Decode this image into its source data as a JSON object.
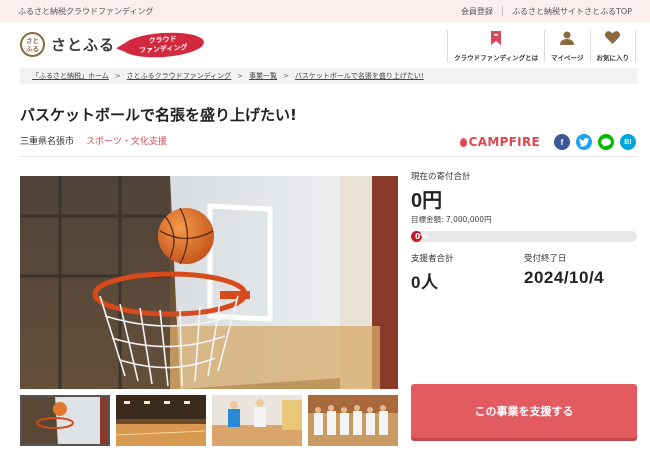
{
  "topbar": {
    "tagline": "ふるさと納税クラウドファンディング",
    "register": "会員登録",
    "site_top": "ふるさと納税サイトさとふるTOP"
  },
  "header": {
    "logo_mark": "さと\nふる",
    "logo_text": "さとふる",
    "badge_line1": "クラウド",
    "badge_line2": "ファンディング",
    "nav": [
      {
        "label": "クラウドファンディングとは",
        "icon": "bookmark-icon"
      },
      {
        "label": "マイページ",
        "icon": "user-icon"
      },
      {
        "label": "お気に入り",
        "icon": "heart-icon"
      }
    ]
  },
  "breadcrumb": [
    "「ふるさと納税」ホーム",
    "さとふるクラウドファンディング",
    "事業一覧",
    "バスケットボールで名張を盛り上げたい!"
  ],
  "project": {
    "title": "バスケットボールで名張を盛り上げたい!",
    "city": "三重県名張市",
    "category": "スポーツ・文化支援"
  },
  "share": {
    "campfire": "CAMPFIRE",
    "buttons": [
      {
        "icon": "facebook-icon",
        "glyph": "f",
        "color": "#3b5998"
      },
      {
        "icon": "twitter-icon",
        "glyph": "t",
        "color": "#1da1f2"
      },
      {
        "icon": "line-icon",
        "glyph": "L",
        "color": "#00b900"
      },
      {
        "icon": "hatena-icon",
        "glyph": "B!",
        "color": "#00a4de"
      }
    ]
  },
  "funding": {
    "current_label": "現在の寄付合計",
    "current_amount": "0円",
    "goal": "目標金額: 7,000,000円",
    "progress_text": "0%",
    "progress_fraction": 0.0,
    "supporters_label": "支援者合計",
    "supporters_value": "0人",
    "deadline_label": "受付終了日",
    "deadline_value": "2024/10/4",
    "support_button": "この事業を支援する"
  },
  "colors": {
    "accent": "#e15b60",
    "progress": "#c0192a",
    "category": "#d64a5b",
    "topbar_bg": "#fbeeee"
  }
}
